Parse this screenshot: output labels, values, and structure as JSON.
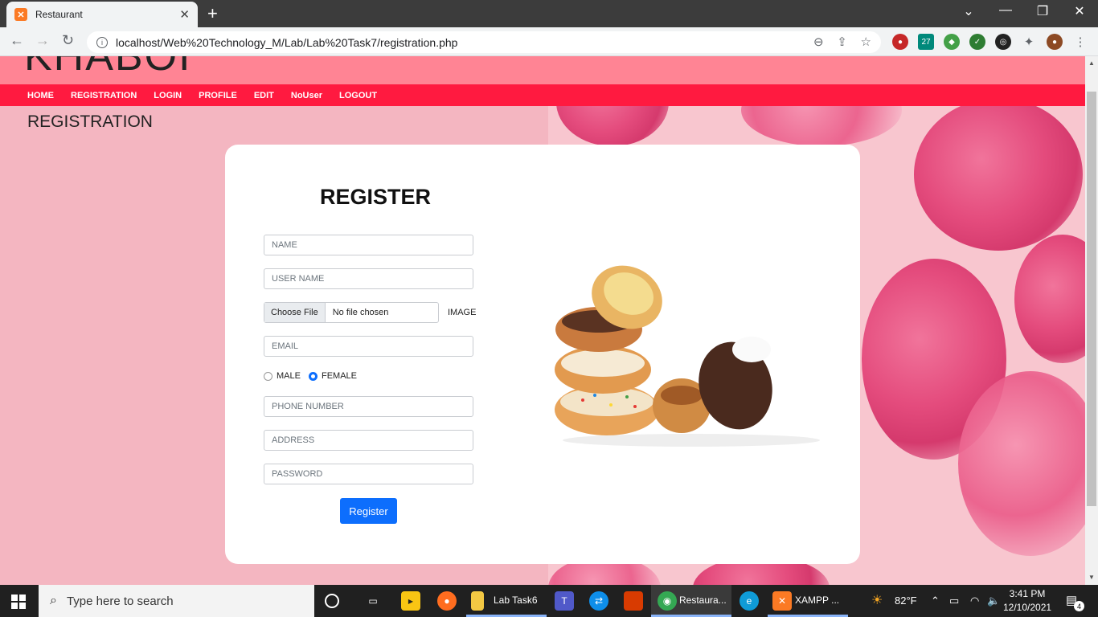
{
  "browser": {
    "tab_title": "Restaurant",
    "url": "localhost/Web%20Technology_M/Lab/Lab%20Task7/registration.php"
  },
  "site": {
    "logo": "KHABOI",
    "menu": [
      "HOME",
      "REGISTRATION",
      "LOGIN",
      "PROFILE",
      "EDIT",
      "NoUser",
      "LOGOUT"
    ],
    "page_heading": "REGISTRATION"
  },
  "form": {
    "title": "REGISTER",
    "name_placeholder": "NAME",
    "username_placeholder": "USER NAME",
    "file_button": "Choose File",
    "file_status": "No file chosen",
    "image_label": "IMAGE",
    "email_placeholder": "EMAIL",
    "gender_male": "MALE",
    "gender_female": "FEMALE",
    "gender_selected": "FEMALE",
    "phone_placeholder": "PHONE NUMBER",
    "address_placeholder": "ADDRESS",
    "password_placeholder": "PASSWORD",
    "submit_label": "Register"
  },
  "taskbar": {
    "search_text": "Type here to search",
    "apps": [
      {
        "label": "Lab Task6"
      },
      {
        "label": "Restaura..."
      },
      {
        "label": "XAMPP ..."
      }
    ],
    "weather": "82°F",
    "time": "3:41 PM",
    "date": "12/10/2021",
    "notification_count": "4"
  },
  "colors": {
    "menu_bar": "#ff1a40",
    "header_band": "#ff8494",
    "page_bg": "#f4b6c1",
    "primary_button": "#0d6efd"
  }
}
